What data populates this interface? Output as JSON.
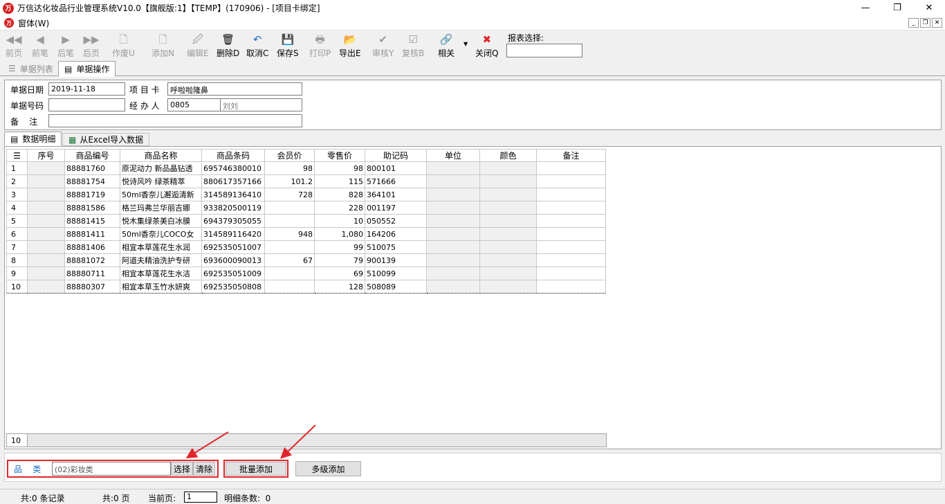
{
  "window": {
    "title": "万信达化妆品行业管理系统V10.0【旗舰版:1】【TEMP】(170906) - [项目卡绑定]",
    "logo_text": "万",
    "min": "—",
    "max": "❐",
    "close": "✕"
  },
  "menu": {
    "item": "窗体(W)"
  },
  "toolbar": {
    "buttons": [
      {
        "id": "first",
        "label": "前页",
        "icon": "◀◀",
        "enabled": false
      },
      {
        "id": "prev",
        "label": "前笔",
        "icon": "◀",
        "enabled": false
      },
      {
        "id": "next",
        "label": "后笔",
        "icon": "▶",
        "enabled": false
      },
      {
        "id": "last",
        "label": "后页",
        "icon": "▶▶",
        "enabled": false
      },
      {
        "id": "void",
        "label": "作废U",
        "icon": "🗋",
        "enabled": false
      },
      {
        "id": "add",
        "label": "添加N",
        "icon": "🗋",
        "enabled": false
      },
      {
        "id": "edit",
        "label": "编辑E",
        "icon": "🖉",
        "enabled": false
      },
      {
        "id": "delete",
        "label": "删除D",
        "icon": "🗑",
        "enabled": true
      },
      {
        "id": "cancel",
        "label": "取消C",
        "icon": "↶",
        "enabled": true
      },
      {
        "id": "save",
        "label": "保存S",
        "icon": "💾",
        "enabled": true
      },
      {
        "id": "print",
        "label": "打印P",
        "icon": "🖶",
        "enabled": false
      },
      {
        "id": "export",
        "label": "导出E",
        "icon": "📂",
        "enabled": true
      },
      {
        "id": "audit",
        "label": "审核Y",
        "icon": "✔",
        "enabled": false
      },
      {
        "id": "reaudit",
        "label": "复核B",
        "icon": "☑",
        "enabled": false
      },
      {
        "id": "related",
        "label": "相关",
        "icon": "🔗",
        "enabled": true
      },
      {
        "id": "close",
        "label": "关闭Q",
        "icon": "✖",
        "enabled": true
      }
    ],
    "report_select_label": "报表选择:",
    "report_select_value": ""
  },
  "tabs": {
    "list": "单据列表",
    "operate": "单据操作"
  },
  "form": {
    "date_label": "单据日期",
    "date_value": "2019-11-18",
    "project_label": "项 目 卡",
    "project_value": "呼啦啦隆鼻",
    "number_label": "单据号码",
    "number_value": "",
    "handler_label": "经 办 人",
    "handler_code": "0805",
    "handler_name": "刘刘",
    "note_label": "备    注",
    "note_value": ""
  },
  "subtabs": {
    "detail": "数据明细",
    "excel": "从Excel导入数据"
  },
  "grid": {
    "headers": [
      "序号",
      "商品编号",
      "商品名称",
      "商品条码",
      "会员价",
      "零售价",
      "助记码",
      "单位",
      "颜色",
      "备注"
    ],
    "rows": [
      {
        "no": "1",
        "code": "88881760",
        "name": "原泥动力 新品晶钻透",
        "barcode": "695746380010",
        "member": "98",
        "retail": "98",
        "mnemonic": "800101"
      },
      {
        "no": "2",
        "code": "88881754",
        "name": "悦诗风吟  绿茶精萃",
        "barcode": "880617357166",
        "member": "101.2",
        "retail": "115",
        "mnemonic": "571666"
      },
      {
        "no": "3",
        "code": "88881719",
        "name": "50ml香奈儿邂逅清新",
        "barcode": "314589136410",
        "member": "728",
        "retail": "828",
        "mnemonic": "364101"
      },
      {
        "no": "4",
        "code": "88881586",
        "name": "格兰玛弗兰华丽吉娜",
        "barcode": "933820500119",
        "member": "",
        "retail": "228",
        "mnemonic": "001197"
      },
      {
        "no": "5",
        "code": "88881415",
        "name": "悦木集绿茶美白冰膜",
        "barcode": "694379305055",
        "member": "",
        "retail": "10",
        "mnemonic": "050552"
      },
      {
        "no": "6",
        "code": "88881411",
        "name": "50ml香奈儿COCO女",
        "barcode": "314589116420",
        "member": "948",
        "retail": "1,080",
        "mnemonic": "164206"
      },
      {
        "no": "7",
        "code": "88881406",
        "name": "相宜本草莲花生水润",
        "barcode": "692535051007",
        "member": "",
        "retail": "99",
        "mnemonic": "510075"
      },
      {
        "no": "8",
        "code": "88881072",
        "name": "阿道夫精油洗护专研",
        "barcode": "693600090013",
        "member": "67",
        "retail": "79",
        "mnemonic": "900139"
      },
      {
        "no": "9",
        "code": "88880711",
        "name": "相宜本草莲花生水洁",
        "barcode": "692535051009",
        "member": "",
        "retail": "69",
        "mnemonic": "510099"
      },
      {
        "no": "10",
        "code": "88880307",
        "name": "相宜本草玉竹水妍爽",
        "barcode": "692535050808",
        "member": "",
        "retail": "128",
        "mnemonic": "508089"
      }
    ],
    "footer_count": "10"
  },
  "bottom": {
    "category_label": "品    类",
    "category_value": "(02)彩妆类",
    "select_btn": "选择",
    "clear_btn": "清除",
    "batch_add_btn": "批量添加",
    "multi_add_btn": "多级添加"
  },
  "status": {
    "records": "共:0 条记录",
    "pages": "共:0 页",
    "current_label": "当前页:",
    "current_value": "1",
    "detail_count": "明细条数:  0"
  },
  "colors": {
    "highlight": "#e0262b",
    "accent_blue": "#1e6fc8"
  }
}
